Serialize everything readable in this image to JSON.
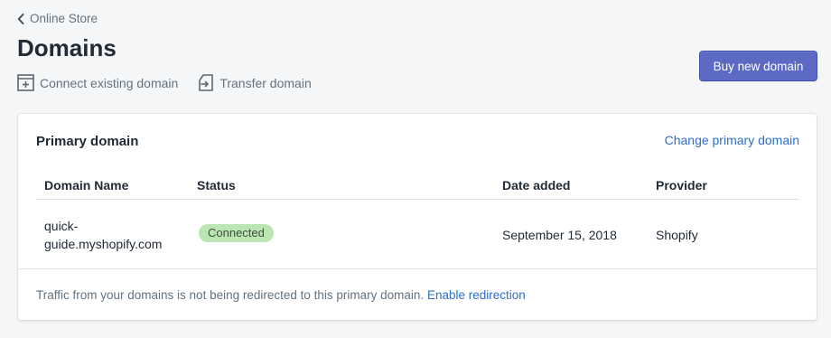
{
  "breadcrumb": {
    "label": "Online Store",
    "icon": "chevron-left-icon"
  },
  "page": {
    "title": "Domains"
  },
  "actions": [
    {
      "label": "Connect existing domain",
      "icon": "connect-domain-icon"
    },
    {
      "label": "Transfer domain",
      "icon": "transfer-domain-icon"
    }
  ],
  "buy_button": {
    "label": "Buy new domain"
  },
  "card": {
    "title": "Primary domain",
    "change_link": "Change primary domain",
    "table": {
      "headers": [
        "Domain Name",
        "Status",
        "Date added",
        "Provider"
      ],
      "rows": [
        {
          "domain": "quick-\nguide.myshopify.com",
          "status": "Connected",
          "date_added": "September 15, 2018",
          "provider": "Shopify"
        }
      ]
    },
    "footer": {
      "text": "Traffic from your domains is not being redirected to this primary domain.",
      "link": "Enable redirection"
    }
  },
  "colors": {
    "primary_button": "#5c6ac4",
    "link": "#2c6ecb",
    "badge_success_bg": "#bbe5b3",
    "page_bg": "#f4f6f8"
  }
}
